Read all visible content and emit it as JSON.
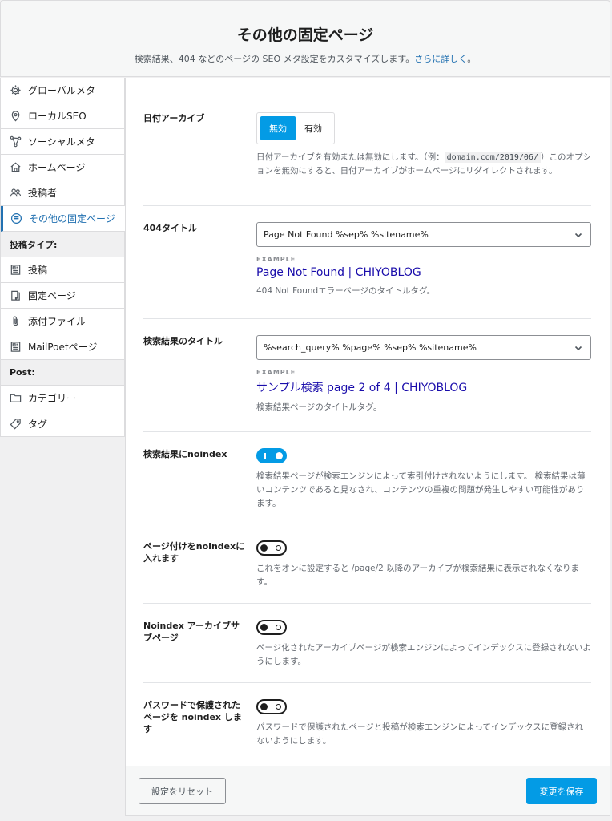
{
  "header": {
    "title": "その他の固定ページ",
    "subtitle": "検索結果、404 などのページの SEO メタ設定をカスタマイズします。",
    "link": "さらに詳しく",
    "period": "。"
  },
  "sidebar": {
    "items": [
      {
        "label": "グローバルメタ",
        "icon": "gear-icon"
      },
      {
        "label": "ローカルSEO",
        "icon": "location-pin-icon"
      },
      {
        "label": "ソーシャルメタ",
        "icon": "share-nodes-icon"
      },
      {
        "label": "ホームページ",
        "icon": "home-icon"
      },
      {
        "label": "投稿者",
        "icon": "users-icon"
      },
      {
        "label": "その他の固定ページ",
        "icon": "list-circle-icon"
      }
    ],
    "post_types_heading": "投稿タイプ:",
    "post_types": [
      {
        "label": "投稿",
        "icon": "post-icon"
      },
      {
        "label": "固定ページ",
        "icon": "page-icon"
      },
      {
        "label": "添付ファイル",
        "icon": "paperclip-icon"
      },
      {
        "label": "MailPoetページ",
        "icon": "newspaper-icon"
      }
    ],
    "post_heading": "Post:",
    "post_items": [
      {
        "label": "カテゴリー",
        "icon": "folder-icon"
      },
      {
        "label": "タグ",
        "icon": "tag-icon"
      }
    ]
  },
  "settings": {
    "date_archive": {
      "label": "日付アーカイブ",
      "off": "無効",
      "on": "有効",
      "desc_1": "日付アーカイブを有効または無効にします。（例：",
      "desc_code": "domain.com/2019/06/",
      "desc_2": "）このオプションを無効にすると、日付アーカイブがホームページにリダイレクトされます。"
    },
    "title_404": {
      "label": "404タイトル",
      "value": "Page Not Found %sep% %sitename%",
      "example_label": "EXAMPLE",
      "example": "Page Not Found | CHIYOBLOG",
      "desc": "404 Not Foundエラーページのタイトルタグ。"
    },
    "search_title": {
      "label": "検索結果のタイトル",
      "value": "%search_query% %page% %sep% %sitename%",
      "example_label": "EXAMPLE",
      "example": "サンプル検索 page 2 of 4 | CHIYOBLOG",
      "desc": "検索結果ページのタイトルタグ。"
    },
    "search_noindex": {
      "label": "検索結果にnoindex",
      "on": true,
      "desc": "検索結果ページが検索エンジンによって索引付けされないようにします。 検索結果は薄いコンテンツであると見なされ、コンテンツの重複の問題が発生しやすい可能性があります。"
    },
    "paginated_noindex": {
      "label": "ページ付けをnoindexに入れます",
      "on": false,
      "desc": "これをオンに設定すると /page/2 以降のアーカイブが検索結果に表示されなくなります。"
    },
    "archive_subpages_noindex": {
      "label": "Noindex アーカイブサブページ",
      "on": false,
      "desc": "ページ化されたアーカイブページが検索エンジンによってインデックスに登録されないようにします。"
    },
    "password_noindex": {
      "label": "パスワードで保護されたページを noindex します",
      "on": false,
      "desc": "パスワードで保護されたページと投稿が検索エンジンによってインデックスに登録されないようにします。"
    }
  },
  "footer": {
    "reset": "設定をリセット",
    "save": "変更を保存"
  }
}
